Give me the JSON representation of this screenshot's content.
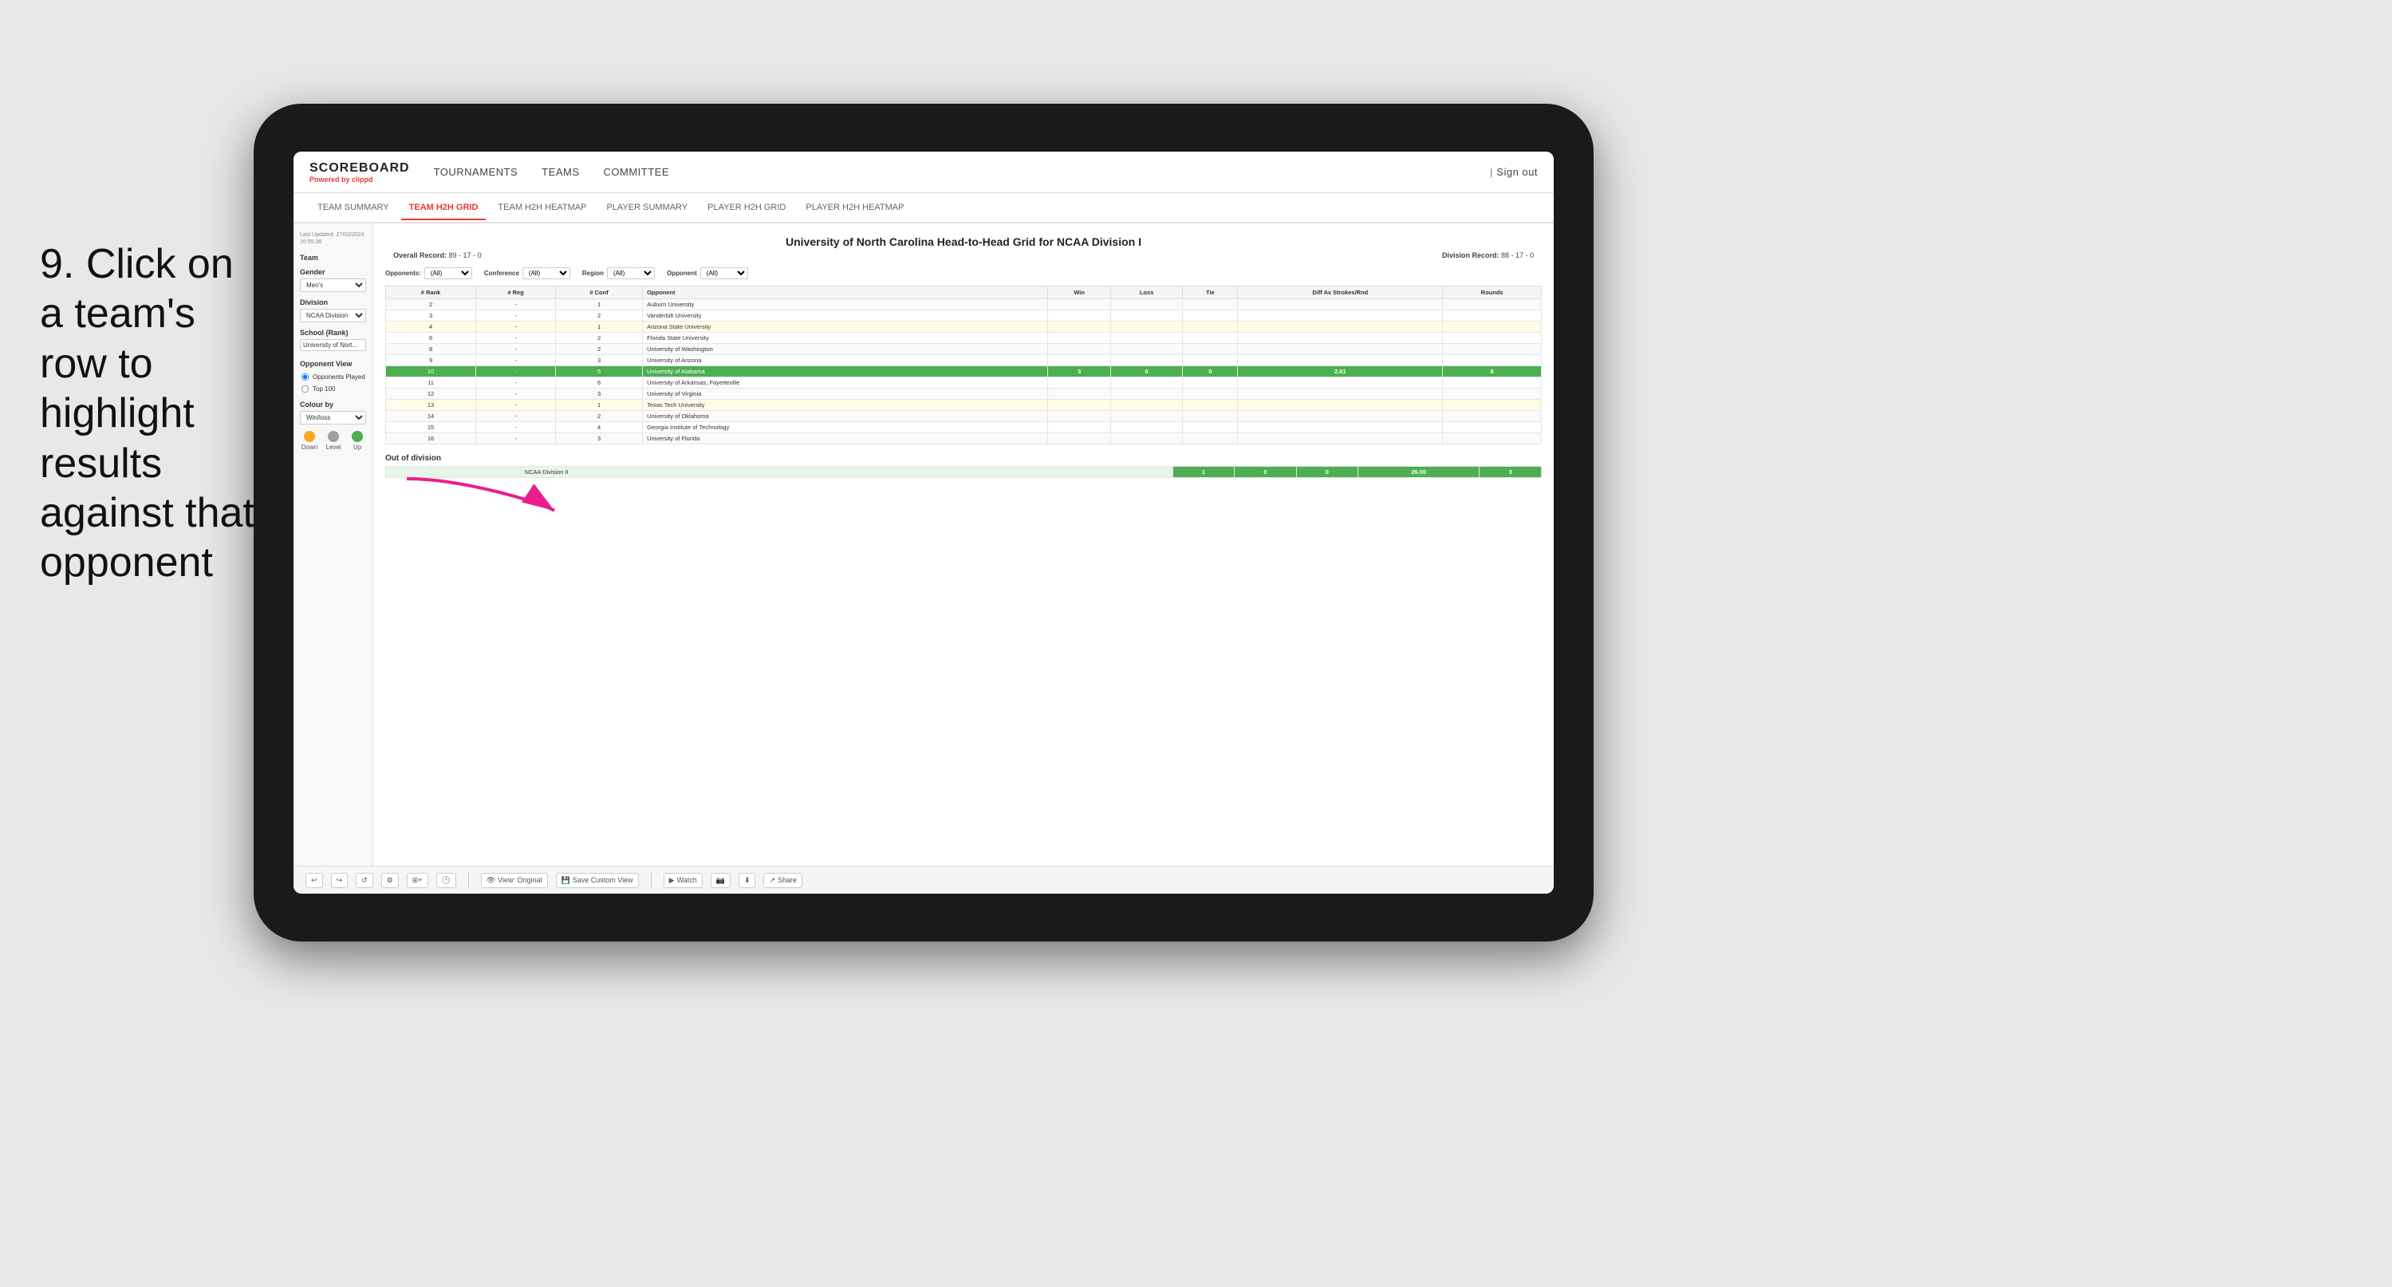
{
  "instruction": {
    "step": "9.",
    "text": "Click on a team's row to highlight results against that opponent"
  },
  "nav": {
    "logo": "SCOREBOARD",
    "logo_sub": "Powered by",
    "logo_brand": "clippd",
    "items": [
      "TOURNAMENTS",
      "TEAMS",
      "COMMITTEE"
    ],
    "sign_out": "Sign out"
  },
  "sub_nav": {
    "items": [
      "TEAM SUMMARY",
      "TEAM H2H GRID",
      "TEAM H2H HEATMAP",
      "PLAYER SUMMARY",
      "PLAYER H2H GRID",
      "PLAYER H2H HEATMAP"
    ],
    "active": "TEAM H2H GRID"
  },
  "sidebar": {
    "timestamp_label": "Last Updated: 27/03/2024",
    "timestamp_time": "16:55:38",
    "team_label": "Team",
    "gender_label": "Gender",
    "gender_value": "Men's",
    "division_label": "Division",
    "division_value": "NCAA Division I",
    "school_label": "School (Rank)",
    "school_value": "University of Nort...",
    "opponent_view_label": "Opponent View",
    "opponent_played": "Opponents Played",
    "opponent_top100": "Top 100",
    "colour_by_label": "Colour by",
    "colour_by_value": "Win/loss",
    "legend": [
      {
        "label": "Down",
        "color": "#f9a825"
      },
      {
        "label": "Level",
        "color": "#9e9e9e"
      },
      {
        "label": "Up",
        "color": "#4caf50"
      }
    ]
  },
  "table": {
    "title": "University of North Carolina Head-to-Head Grid for NCAA Division I",
    "overall_record_label": "Overall Record:",
    "overall_record": "89 - 17 - 0",
    "division_record_label": "Division Record:",
    "division_record": "88 - 17 - 0",
    "filters": {
      "opponents_label": "Opponents:",
      "opponents_value": "(All)",
      "conference_label": "Conference",
      "conference_value": "(All)",
      "region_label": "Region",
      "region_value": "(All)",
      "opponent_label": "Opponent",
      "opponent_value": "(All)"
    },
    "columns": [
      "# Rank",
      "# Reg",
      "# Conf",
      "Opponent",
      "Win",
      "Loss",
      "Tie",
      "Diff Av Strokes/Rnd",
      "Rounds"
    ],
    "rows": [
      {
        "rank": "2",
        "reg": "-",
        "conf": "1",
        "opponent": "Auburn University",
        "win": "",
        "loss": "",
        "tie": "",
        "diff": "",
        "rounds": "",
        "highlight": false,
        "bg": "light"
      },
      {
        "rank": "3",
        "reg": "-",
        "conf": "2",
        "opponent": "Vanderbilt University",
        "win": "",
        "loss": "",
        "tie": "",
        "diff": "",
        "rounds": "",
        "highlight": false,
        "bg": "light"
      },
      {
        "rank": "4",
        "reg": "-",
        "conf": "1",
        "opponent": "Arizona State University",
        "win": "",
        "loss": "",
        "tie": "",
        "diff": "",
        "rounds": "",
        "highlight": false,
        "bg": "lightyellow"
      },
      {
        "rank": "6",
        "reg": "-",
        "conf": "2",
        "opponent": "Florida State University",
        "win": "",
        "loss": "",
        "tie": "",
        "diff": "",
        "rounds": "",
        "highlight": false,
        "bg": "light"
      },
      {
        "rank": "8",
        "reg": "-",
        "conf": "2",
        "opponent": "University of Washington",
        "win": "",
        "loss": "",
        "tie": "",
        "diff": "",
        "rounds": "",
        "highlight": false,
        "bg": "light"
      },
      {
        "rank": "9",
        "reg": "-",
        "conf": "3",
        "opponent": "University of Arizona",
        "win": "",
        "loss": "",
        "tie": "",
        "diff": "",
        "rounds": "",
        "highlight": false,
        "bg": "light"
      },
      {
        "rank": "10",
        "reg": "-",
        "conf": "5",
        "opponent": "University of Alabama",
        "win": "3",
        "loss": "0",
        "tie": "0",
        "diff": "2.61",
        "rounds": "8",
        "highlight": true,
        "bg": "green"
      },
      {
        "rank": "11",
        "reg": "-",
        "conf": "6",
        "opponent": "University of Arkansas, Fayetteville",
        "win": "",
        "loss": "",
        "tie": "",
        "diff": "",
        "rounds": "",
        "highlight": false,
        "bg": "light"
      },
      {
        "rank": "12",
        "reg": "-",
        "conf": "3",
        "opponent": "University of Virginia",
        "win": "",
        "loss": "",
        "tie": "",
        "diff": "",
        "rounds": "",
        "highlight": false,
        "bg": "light"
      },
      {
        "rank": "13",
        "reg": "-",
        "conf": "1",
        "opponent": "Texas Tech University",
        "win": "",
        "loss": "",
        "tie": "",
        "diff": "",
        "rounds": "",
        "highlight": false,
        "bg": "lightyellow"
      },
      {
        "rank": "14",
        "reg": "-",
        "conf": "2",
        "opponent": "University of Oklahoma",
        "win": "",
        "loss": "",
        "tie": "",
        "diff": "",
        "rounds": "",
        "highlight": false,
        "bg": "light"
      },
      {
        "rank": "15",
        "reg": "-",
        "conf": "4",
        "opponent": "Georgia Institute of Technology",
        "win": "",
        "loss": "",
        "tie": "",
        "diff": "",
        "rounds": "",
        "highlight": false,
        "bg": "light"
      },
      {
        "rank": "16",
        "reg": "-",
        "conf": "3",
        "opponent": "University of Florida",
        "win": "",
        "loss": "",
        "tie": "",
        "diff": "",
        "rounds": "",
        "highlight": false,
        "bg": "light"
      }
    ],
    "out_of_division_label": "Out of division",
    "out_of_division_row": {
      "label": "NCAA Division II",
      "win": "1",
      "loss": "0",
      "tie": "0",
      "diff": "26.00",
      "rounds": "3"
    }
  },
  "toolbar": {
    "view_original": "View: Original",
    "save_custom": "Save Custom View",
    "watch": "Watch",
    "share": "Share"
  }
}
